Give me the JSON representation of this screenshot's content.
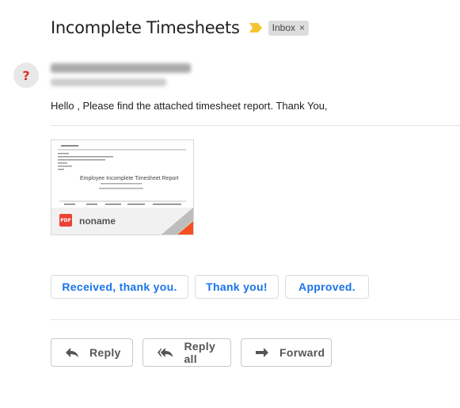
{
  "email": {
    "subject": "Incomplete Timesheets",
    "label": "Inbox",
    "label_close": "×",
    "avatar_glyph": "?",
    "body": "Hello , Please find the attached timesheet report. Thank You,"
  },
  "attachment": {
    "type_badge": "PDF",
    "filename": "noname",
    "preview_title": "Employee Incomplete Timesheet Report"
  },
  "smart_replies": [
    "Received, thank you.",
    "Thank you!",
    "Approved."
  ],
  "actions": {
    "reply": "Reply",
    "reply_all": "Reply all",
    "forward": "Forward"
  },
  "colors": {
    "importance_marker": "#f4c430",
    "accent_link": "#1a73e8",
    "pdf_red": "#ea4335",
    "avatar_question": "#d93025"
  }
}
